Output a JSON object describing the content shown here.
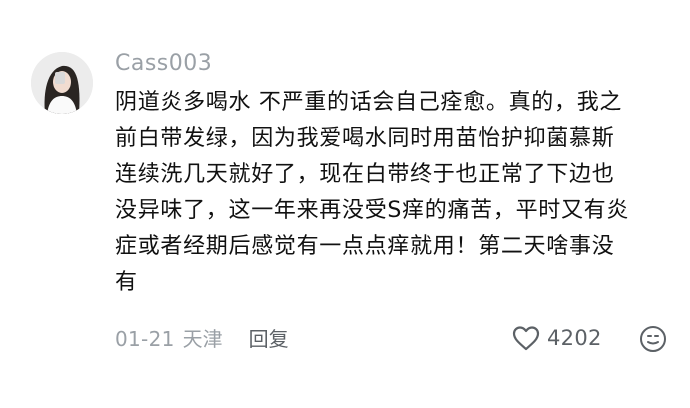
{
  "comment": {
    "username": "Cass003",
    "content_lines": [
      "阴道炎多喝水 不严重的话会自己痊愈。真的，我之",
      "前白带发绿，因为我爱喝水同时用苗怡护抑菌慕斯",
      "连续洗几天就好了，现在白带终于也正常了下边也",
      "没异味了，这一年来再没受S痒的痛苦，平时又有炎",
      "症或者经期后感觉有一点点痒就用！第二天啥事没",
      "有"
    ],
    "date": "01-21",
    "region": "天津",
    "reply_label": "回复",
    "like_count": "4202",
    "icons": {
      "like": "heart-icon",
      "emoji": "emoji-face-icon"
    },
    "colors": {
      "meta_text": "#9aa0a6",
      "body_text": "#111111"
    }
  }
}
